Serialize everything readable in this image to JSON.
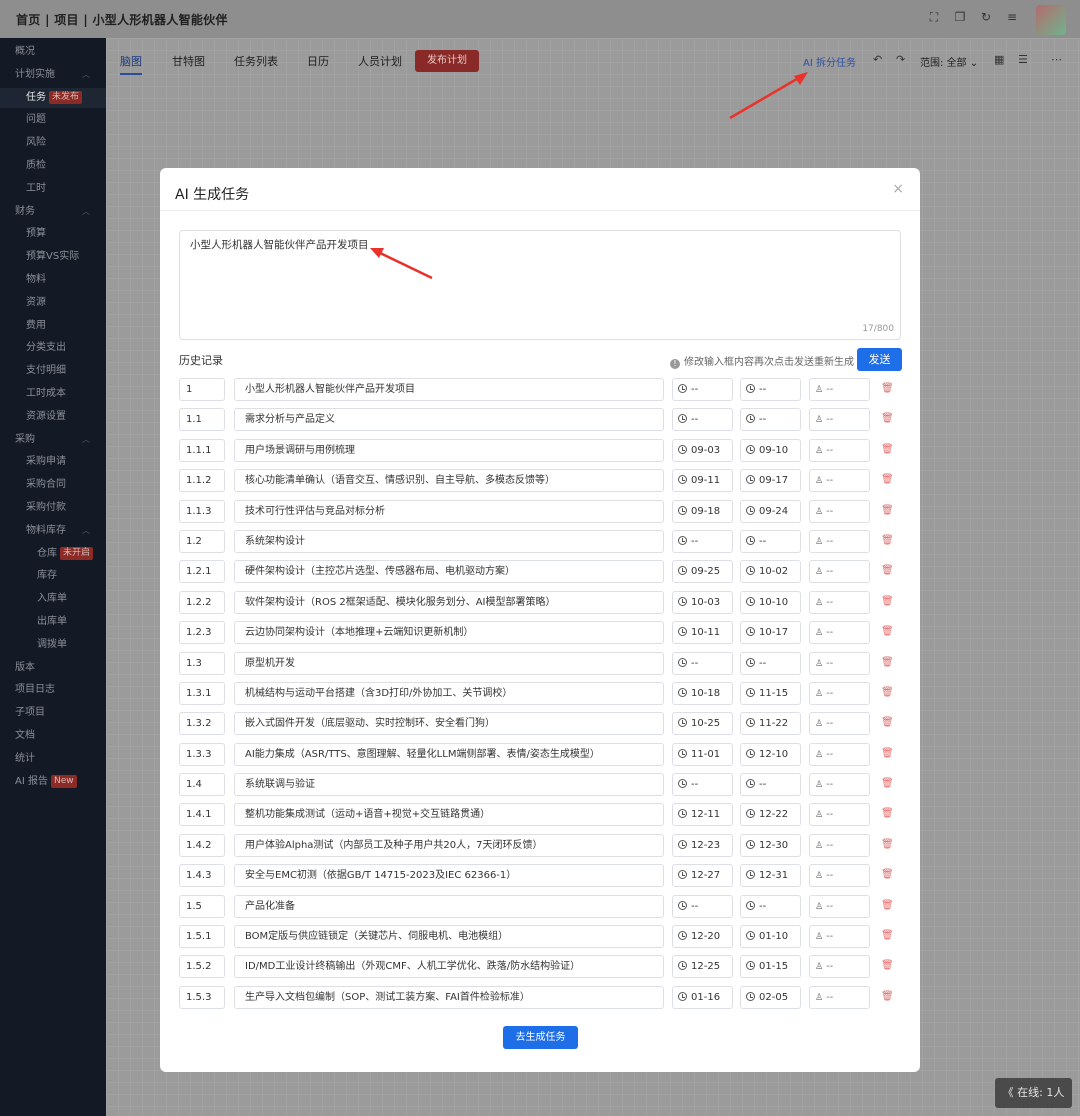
{
  "header": {
    "breadcrumb": "首页 | 项目 | 小型人形机器人智能伙伴",
    "icons": [
      "fullscreen-icon",
      "copy-icon",
      "refresh-icon",
      "menu-icon"
    ]
  },
  "sidebar": {
    "items": [
      {
        "label": "概况"
      },
      {
        "label": "计划实施"
      },
      {
        "label": "任务",
        "badge": "未发布"
      },
      {
        "label": "问题"
      },
      {
        "label": "风险"
      },
      {
        "label": "质检"
      },
      {
        "label": "工时"
      },
      {
        "label": "财务"
      },
      {
        "label": "预算"
      },
      {
        "label": "预算VS实际"
      },
      {
        "label": "物料"
      },
      {
        "label": "资源"
      },
      {
        "label": "费用"
      },
      {
        "label": "分类支出"
      },
      {
        "label": "支付明细"
      },
      {
        "label": "工时成本"
      },
      {
        "label": "资源设置"
      },
      {
        "label": "采购"
      },
      {
        "label": "采购申请"
      },
      {
        "label": "采购合同"
      },
      {
        "label": "采购付款"
      },
      {
        "label": "物料库存"
      },
      {
        "label": "仓库",
        "badge": "未开启"
      },
      {
        "label": "库存"
      },
      {
        "label": "入库单"
      },
      {
        "label": "出库单"
      },
      {
        "label": "调拨单"
      },
      {
        "label": "版本"
      },
      {
        "label": "项目日志"
      },
      {
        "label": "子项目"
      },
      {
        "label": "文档"
      },
      {
        "label": "统计"
      },
      {
        "label": "AI 报告",
        "badge": "New"
      }
    ]
  },
  "toolbar": {
    "tabs": [
      "脑图",
      "甘特图",
      "任务列表",
      "日历",
      "人员计划"
    ],
    "publish": "发布计划",
    "ai_split": "AI 拆分任务",
    "scope": "范围: 全部"
  },
  "modal": {
    "title": "AI 生成任务",
    "prompt_value": "小型人形机器人智能伙伴产品开发项目",
    "prompt_count": "17/800",
    "history_label": "历史记录",
    "hint": "修改输入框内容再次点击发送重新生成",
    "send": "发送",
    "generate": "去生成任务",
    "owner_placeholder": "--",
    "tasks": [
      {
        "num": "1",
        "name": "小型人形机器人智能伙伴产品开发项目",
        "start": "--",
        "end": "--"
      },
      {
        "num": "1.1",
        "name": "需求分析与产品定义",
        "start": "--",
        "end": "--"
      },
      {
        "num": "1.1.1",
        "name": "用户场景调研与用例梳理",
        "start": "09-03",
        "end": "09-10"
      },
      {
        "num": "1.1.2",
        "name": "核心功能清单确认（语音交互、情感识别、自主导航、多模态反馈等）",
        "start": "09-11",
        "end": "09-17"
      },
      {
        "num": "1.1.3",
        "name": "技术可行性评估与竞品对标分析",
        "start": "09-18",
        "end": "09-24"
      },
      {
        "num": "1.2",
        "name": "系统架构设计",
        "start": "--",
        "end": "--"
      },
      {
        "num": "1.2.1",
        "name": "硬件架构设计（主控芯片选型、传感器布局、电机驱动方案）",
        "start": "09-25",
        "end": "10-02"
      },
      {
        "num": "1.2.2",
        "name": "软件架构设计（ROS 2框架适配、模块化服务划分、AI模型部署策略）",
        "start": "10-03",
        "end": "10-10"
      },
      {
        "num": "1.2.3",
        "name": "云边协同架构设计（本地推理+云端知识更新机制）",
        "start": "10-11",
        "end": "10-17"
      },
      {
        "num": "1.3",
        "name": "原型机开发",
        "start": "--",
        "end": "--"
      },
      {
        "num": "1.3.1",
        "name": "机械结构与运动平台搭建（含3D打印/外协加工、关节调校）",
        "start": "10-18",
        "end": "11-15"
      },
      {
        "num": "1.3.2",
        "name": "嵌入式固件开发（底层驱动、实时控制环、安全看门狗）",
        "start": "10-25",
        "end": "11-22"
      },
      {
        "num": "1.3.3",
        "name": "AI能力集成（ASR/TTS、意图理解、轻量化LLM端侧部署、表情/姿态生成模型）",
        "start": "11-01",
        "end": "12-10"
      },
      {
        "num": "1.4",
        "name": "系统联调与验证",
        "start": "--",
        "end": "--"
      },
      {
        "num": "1.4.1",
        "name": "整机功能集成测试（运动+语音+视觉+交互链路贯通）",
        "start": "12-11",
        "end": "12-22"
      },
      {
        "num": "1.4.2",
        "name": "用户体验Alpha测试（内部员工及种子用户共20人，7天闭环反馈）",
        "start": "12-23",
        "end": "12-30"
      },
      {
        "num": "1.4.3",
        "name": "安全与EMC初测（依据GB/T 14715-2023及IEC 62366-1）",
        "start": "12-27",
        "end": "12-31"
      },
      {
        "num": "1.5",
        "name": "产品化准备",
        "start": "--",
        "end": "--"
      },
      {
        "num": "1.5.1",
        "name": "BOM定版与供应链锁定（关键芯片、伺服电机、电池模组）",
        "start": "12-20",
        "end": "01-10"
      },
      {
        "num": "1.5.2",
        "name": "ID/MD工业设计终稿输出（外观CMF、人机工学优化、跌落/防水结构验证）",
        "start": "12-25",
        "end": "01-15"
      },
      {
        "num": "1.5.3",
        "name": "生产导入文档包编制（SOP、测试工装方案、FAI首件检验标准）",
        "start": "01-16",
        "end": "02-05"
      }
    ]
  },
  "online": "《 在线: 1人",
  "colors": {
    "primary": "#1e6ee8",
    "danger": "#e06c6c",
    "sidebar": "#131925"
  }
}
